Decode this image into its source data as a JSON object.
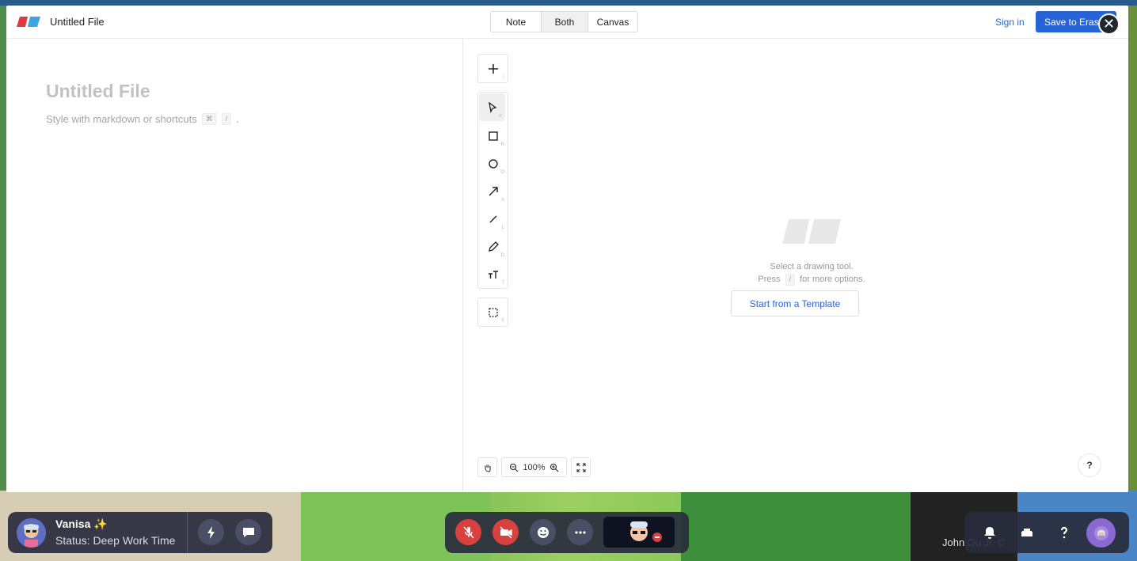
{
  "header": {
    "file_title": "Untitled File",
    "tabs": [
      "Note",
      "Both",
      "Canvas"
    ],
    "active_tab": "Both",
    "sign_in": "Sign in",
    "save_label": "Save to Eraser",
    "close_glyph": "✕"
  },
  "note": {
    "title_placeholder": "Untitled File",
    "hint_prefix": "Style with markdown or shortcuts",
    "hint_key1": "⌘",
    "hint_key2": "/",
    "hint_suffix": "."
  },
  "canvas": {
    "tools": [
      {
        "name": "add",
        "icon": "plus-icon",
        "shortcut": "/"
      },
      {
        "name": "select",
        "icon": "cursor-icon",
        "shortcut": "V"
      },
      {
        "name": "rectangle",
        "icon": "square-icon",
        "shortcut": "R"
      },
      {
        "name": "ellipse",
        "icon": "circle-icon",
        "shortcut": "O"
      },
      {
        "name": "arrow",
        "icon": "arrow-icon",
        "shortcut": "A"
      },
      {
        "name": "line",
        "icon": "line-icon",
        "shortcut": "L"
      },
      {
        "name": "pencil",
        "icon": "pencil-icon",
        "shortcut": "D"
      },
      {
        "name": "text",
        "icon": "text-icon",
        "shortcut": "T"
      },
      {
        "name": "frame",
        "icon": "frame-icon",
        "shortcut": "F"
      }
    ],
    "empty_line1": "Select a drawing tool.",
    "empty_line2_prefix": "Press",
    "empty_line2_key": "/",
    "empty_line2_suffix": "for more options.",
    "template_button": "Start from a Template",
    "zoom_level": "100%",
    "help_label": "?"
  },
  "gamebar": {
    "user_name": "Vanisa ✨",
    "user_status": "Status: Deep Work Time",
    "player_label": "John Ou Jr. C"
  },
  "colors": {
    "accent": "#2563d6",
    "link": "#2b63d8",
    "mute_red": "#d94040",
    "bar_bg": "#282c3c"
  }
}
